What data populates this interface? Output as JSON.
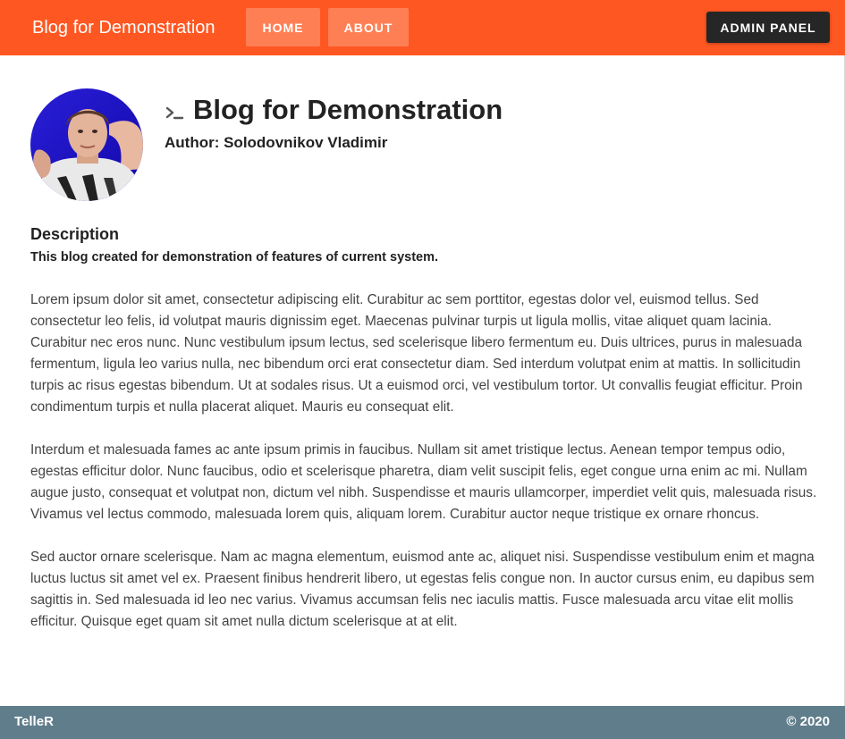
{
  "navbar": {
    "brand": "Blog for Demonstration",
    "home_label": "HOME",
    "about_label": "ABOUT",
    "admin_label": "ADMIN PANEL",
    "color": "#ff5722"
  },
  "header": {
    "avatar_icon": "user-photo",
    "terminal_icon": "terminal-prompt-icon",
    "title": "Blog for Demonstration",
    "author": "Author: Solodovnikov Vladimir"
  },
  "description": {
    "heading": "Description",
    "subtitle": "This blog created for demonstration of features of current system.",
    "paragraphs": [
      "Lorem ipsum dolor sit amet, consectetur adipiscing elit. Curabitur ac sem porttitor, egestas dolor vel, euismod tellus. Sed consectetur leo felis, id volutpat mauris dignissim eget. Maecenas pulvinar turpis ut ligula mollis, vitae aliquet quam lacinia. Curabitur nec eros nunc. Nunc vestibulum ipsum lectus, sed scelerisque libero fermentum eu. Duis ultrices, purus in malesuada fermentum, ligula leo varius nulla, nec bibendum orci erat consectetur diam. Sed interdum volutpat enim at mattis. In sollicitudin turpis ac risus egestas bibendum. Ut at sodales risus. Ut a euismod orci, vel vestibulum tortor. Ut convallis feugiat efficitur. Proin condimentum turpis et nulla placerat aliquet. Mauris eu consequat elit.",
      "Interdum et malesuada fames ac ante ipsum primis in faucibus. Nullam sit amet tristique lectus. Aenean tempor tempus odio, egestas efficitur dolor. Nunc faucibus, odio et scelerisque pharetra, diam velit suscipit felis, eget congue urna enim ac mi. Nullam augue justo, consequat et volutpat non, dictum vel nibh. Suspendisse et mauris ullamcorper, imperdiet velit quis, malesuada risus. Vivamus vel lectus commodo, malesuada lorem quis, aliquam lorem. Curabitur auctor neque tristique ex ornare rhoncus.",
      "Sed auctor ornare scelerisque. Nam ac magna elementum, euismod ante ac, aliquet nisi. Suspendisse vestibulum enim et magna luctus luctus sit amet vel ex. Praesent finibus hendrerit libero, ut egestas felis congue non. In auctor cursus enim, eu dapibus sem sagittis in. Sed malesuada id leo nec varius. Vivamus accumsan felis nec iaculis mattis. Fusce malesuada arcu vitae elit mollis efficitur. Quisque eget quam sit amet nulla dictum scelerisque at at elit."
    ]
  },
  "footer": {
    "brand": "TelleR",
    "copyright": "© 2020",
    "color": "#607d8b"
  }
}
